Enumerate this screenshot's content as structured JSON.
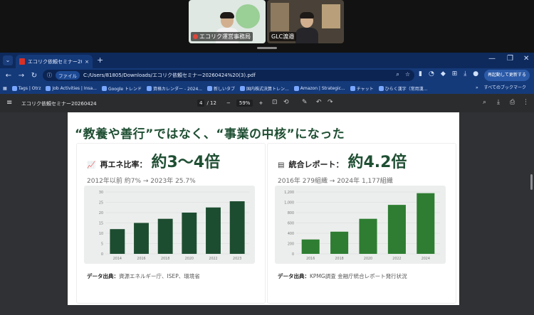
{
  "call": {
    "tiles": [
      {
        "name": "エコリク運営事務局",
        "muted": true
      },
      {
        "name": "GLC渡邉",
        "muted": false
      }
    ]
  },
  "browser": {
    "tab_title": "エコリク依頼セミナー20260424",
    "new_tab": "+",
    "url_chip": "ファイル",
    "url": "C:/Users/81805/Downloads/エコリク依頼セミナー20260424%20(3).pdf",
    "relaunch_label": "再起動して更新する",
    "bookmarks": [
      "Tags | Otrz",
      "Job Activities | Insa...",
      "Google トレンド",
      "資格カレンダー - 2024...",
      "新しいタブ",
      "国内株式決算トレン...",
      "Amazon | Strategic...",
      "チャット",
      "ひらく漢字（常用漢..."
    ],
    "all_bookmarks": "すべてのブックマーク"
  },
  "pdf": {
    "title": "エコリク依頼セミナー20260424",
    "page_current": "4",
    "page_total": "/ 12",
    "zoom": "59%",
    "headline": "“教養や善行”ではなく、“事業の中核”になった"
  },
  "panels": {
    "left": {
      "icon": "trend-chart-icon",
      "label": "再エネ比率：",
      "big": "約3〜4倍",
      "sub": "2012年以前 約7% → 2023年 25.7%",
      "source_label": "データ出典：",
      "source_text": "資源エネルギー庁、ISEP、環境省"
    },
    "right": {
      "icon": "report-icon",
      "label": "統合レポート：",
      "big": "約4.2倍",
      "sub": "2016年 279組織 → 2024年 1,177組織",
      "source_label": "データ出典：",
      "source_text": "KPMG調査 金融庁統合レポート発行状況"
    }
  },
  "colors": {
    "accent": "#1f4f33",
    "bar_left": "#1d4d30",
    "bar_right": "#2e7d32"
  },
  "chart_data": [
    {
      "type": "bar",
      "categories": [
        "2014",
        "2016",
        "2018",
        "2020",
        "2022",
        "2023"
      ],
      "values": [
        12,
        15,
        17,
        20,
        22.5,
        25.5
      ],
      "ylim": [
        0,
        30
      ],
      "yticks": [
        0,
        5,
        10,
        15,
        20,
        25,
        30
      ],
      "grid": true
    },
    {
      "type": "bar",
      "categories": [
        "2016",
        "2018",
        "2020",
        "2022",
        "2024"
      ],
      "values": [
        279,
        430,
        680,
        950,
        1177
      ],
      "ylim": [
        0,
        1200
      ],
      "yticks": [
        0,
        200,
        400,
        600,
        800,
        1000,
        1200
      ],
      "ytick_labels": [
        "0",
        "200",
        "400",
        "600",
        "800",
        "1,000",
        "1,200"
      ],
      "grid": true
    }
  ]
}
